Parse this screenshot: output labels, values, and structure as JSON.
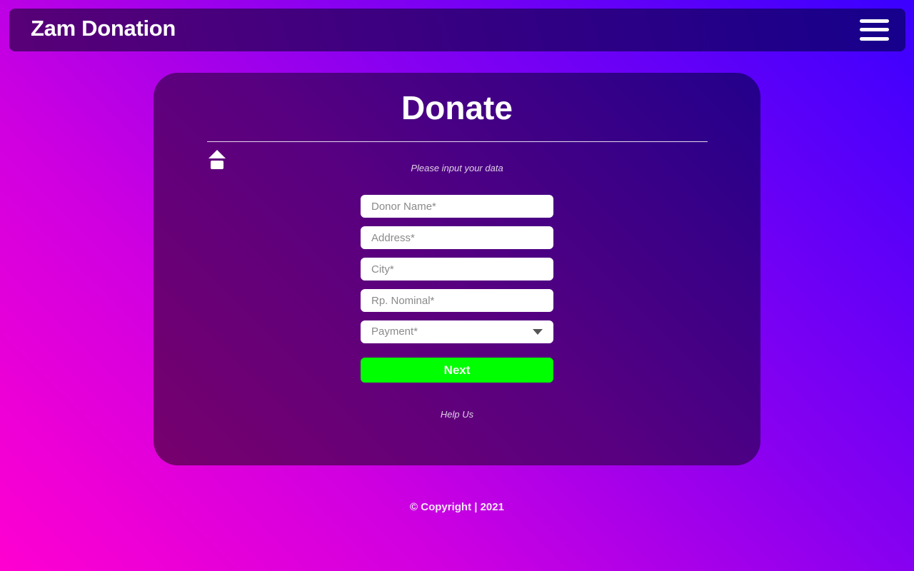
{
  "navbar": {
    "brand": "Zam Donation",
    "menu_icon": "hamburger-menu-icon"
  },
  "card": {
    "title": "Donate",
    "home_icon": "home-icon",
    "subtitle": "Please input your data",
    "fields": {
      "donor_name_placeholder": "Donor Name*",
      "address_placeholder": "Address*",
      "city_placeholder": "City*",
      "nominal_placeholder": "Rp. Nominal*"
    },
    "payment": {
      "selected": "Payment*",
      "arrow_icon": "caret-down-icon"
    },
    "next_label": "Next",
    "help_link": "Help Us"
  },
  "footer": {
    "copyright": "© Copyright | 2021"
  },
  "colors": {
    "next_button": "#00ff00",
    "background_start": "#ff00d0",
    "background_end": "#3a00ff"
  }
}
